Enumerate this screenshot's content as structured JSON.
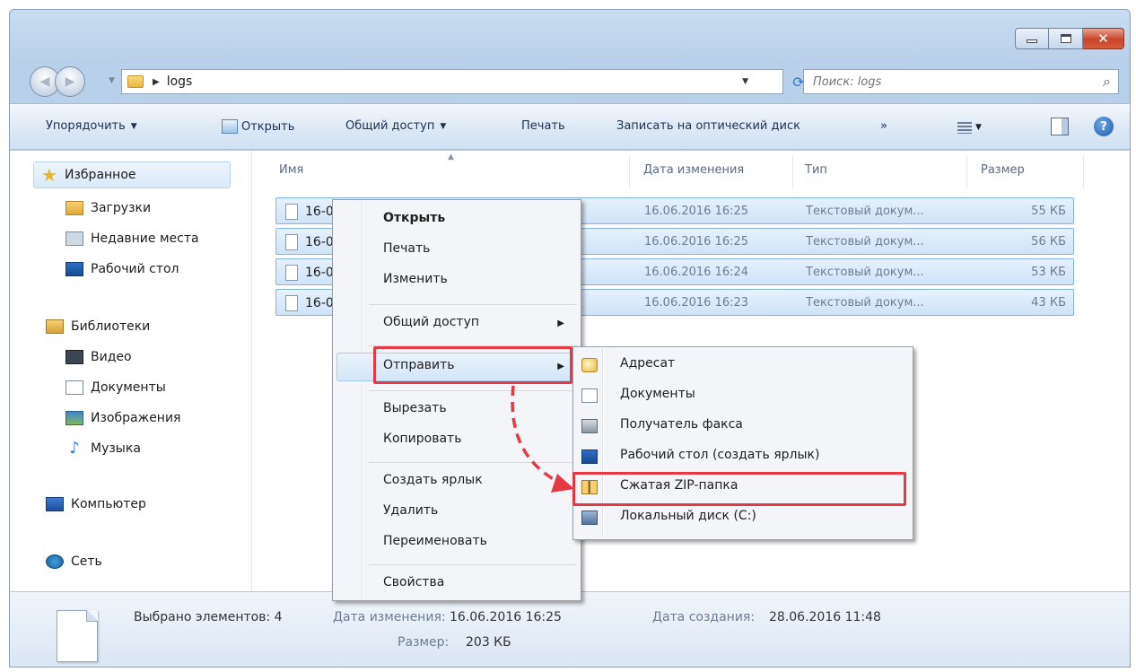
{
  "address": {
    "crumb": "logs",
    "search_placeholder": "Поиск: logs"
  },
  "toolbar": {
    "organize": "Упорядочить",
    "open": "Открыть",
    "share": "Общий доступ",
    "print": "Печать",
    "burn": "Записать на оптический диск",
    "more": "»"
  },
  "nav": {
    "favorites": "Избранное",
    "downloads": "Загрузки",
    "recent": "Недавние места",
    "desktop": "Рабочий стол",
    "libraries": "Библиотеки",
    "video": "Видео",
    "documents": "Документы",
    "images": "Изображения",
    "music": "Музыка",
    "computer": "Компьютер",
    "network": "Сеть"
  },
  "columns": {
    "name": "Имя",
    "date": "Дата изменения",
    "type": "Тип",
    "size": "Размер"
  },
  "files": [
    {
      "name": "16-06-2016.log.130674",
      "date": "16.06.2016 16:25",
      "type": "Текстовый докум...",
      "size": "55 КБ"
    },
    {
      "name": "16-06-2016.log",
      "date": "16.06.2016 16:25",
      "type": "Текстовый докум...",
      "size": "56 КБ"
    },
    {
      "name": "16-06-2016.log",
      "date": "16.06.2016 16:24",
      "type": "Текстовый докум...",
      "size": "53 КБ"
    },
    {
      "name": "16-06-2016.log",
      "date": "16.06.2016 16:23",
      "type": "Текстовый докум...",
      "size": "43 КБ"
    }
  ],
  "context_menu": {
    "open": "Открыть",
    "print": "Печать",
    "edit": "Изменить",
    "share": "Общий доступ",
    "send_to": "Отправить",
    "cut": "Вырезать",
    "copy": "Копировать",
    "create_shortcut": "Создать ярлык",
    "delete": "Удалить",
    "rename": "Переименовать",
    "properties": "Свойства"
  },
  "send_to_menu": {
    "mail": "Адресат",
    "documents": "Документы",
    "fax": "Получатель факса",
    "desktop": "Рабочий стол (создать ярлык)",
    "zip": "Сжатая ZIP-папка",
    "disk": "Локальный диск (C:)"
  },
  "details": {
    "selected": "Выбрано элементов: 4",
    "modified_label": "Дата изменения:",
    "modified_value": "16.06.2016 16:25",
    "size_label": "Размер:",
    "size_value": "203 КБ",
    "created_label": "Дата создания:",
    "created_value": "28.06.2016 11:48"
  },
  "colors": {
    "highlight_red": "#e53a43",
    "selection_blue": "#cfe3f8"
  },
  "icons": [
    "back-icon",
    "forward-icon",
    "folder-icon",
    "refresh-icon",
    "search-icon",
    "open-icon",
    "view-icon",
    "preview-pane-icon",
    "help-icon",
    "star-icon",
    "downloads-icon",
    "recent-places-icon",
    "desktop-icon",
    "libraries-icon",
    "video-icon",
    "documents-icon",
    "images-icon",
    "music-icon",
    "computer-icon",
    "network-icon",
    "text-file-icon",
    "mail-icon",
    "fax-icon",
    "zip-folder-icon",
    "local-disk-icon"
  ]
}
